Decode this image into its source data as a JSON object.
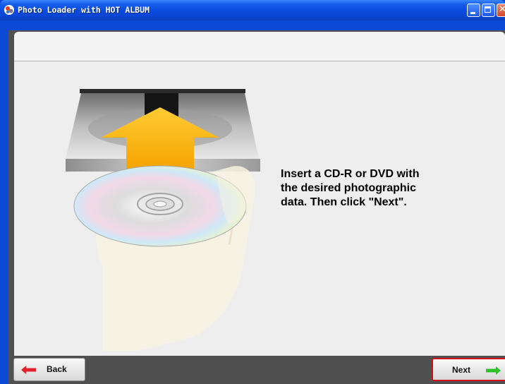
{
  "window": {
    "title": "Photo Loader with HOT ALBUM",
    "app_icon": "app-logo-icon",
    "controls": [
      "minimize-icon",
      "maximize-icon",
      "close-icon"
    ]
  },
  "content": {
    "instruction": "Insert a CD-R or DVD with\nthe desired photographic\ndata. Then click \"Next\".",
    "illustration": "hand-inserting-disc-into-drive"
  },
  "buttons": {
    "back_label": "Back",
    "next_label": "Next",
    "back_icon": "arrow-left-icon",
    "next_icon": "arrow-right-icon"
  },
  "colors": {
    "titlebar": "#0b4be0",
    "back_arrow": "#e3212c",
    "next_arrow": "#2ec12e",
    "next_border": "#d0101c",
    "upload_arrow": "#f7b500"
  }
}
